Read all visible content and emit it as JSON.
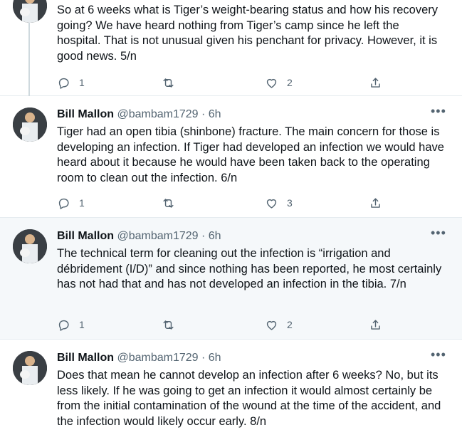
{
  "tweets": [
    {
      "name": "",
      "handle": "",
      "time": "",
      "text": "So at 6 weeks what is Tiger’s weight-bearing status and how his recovery going? We have heard nothing from Tiger’s camp since he left the hospital. That is not unusual given his penchant for privacy. However, it is good news. 5/n",
      "replies": "1",
      "retweets": "",
      "likes": "2"
    },
    {
      "name": "Bill Mallon",
      "handle": "@bambam1729",
      "time": "6h",
      "text": "Tiger had an open tibia (shinbone) fracture. The main concern for those is developing an infection. If Tiger had developed an infection we would have heard about it because he would have been taken back to the operating room to clean out the infection. 6/n",
      "replies": "1",
      "retweets": "",
      "likes": "3"
    },
    {
      "name": "Bill Mallon",
      "handle": "@bambam1729",
      "time": "6h",
      "text": "The technical term for cleaning out the infection is “irrigation and débridement (I/D)” and since nothing has been reported, he most certainly has not had that and has not developed an infection in the tibia. 7/n",
      "replies": "1",
      "retweets": "",
      "likes": "2"
    },
    {
      "name": "Bill Mallon",
      "handle": "@bambam1729",
      "time": "6h",
      "text": "Does that mean he cannot develop an infection after 6 weeks? No, but its less likely. If he was going to get an infection it would almost certainly be from the initial contamination of the wound at the time of the accident, and the infection would likely occur early. 8/n",
      "replies": "",
      "retweets": "",
      "likes": ""
    }
  ],
  "separator": "·",
  "more_icon": "more-icon",
  "colors": {
    "text": "#0f1419",
    "secondary": "#536471",
    "highlight_bg": "#f5f8fa",
    "thread_line": "#cfd9de"
  }
}
